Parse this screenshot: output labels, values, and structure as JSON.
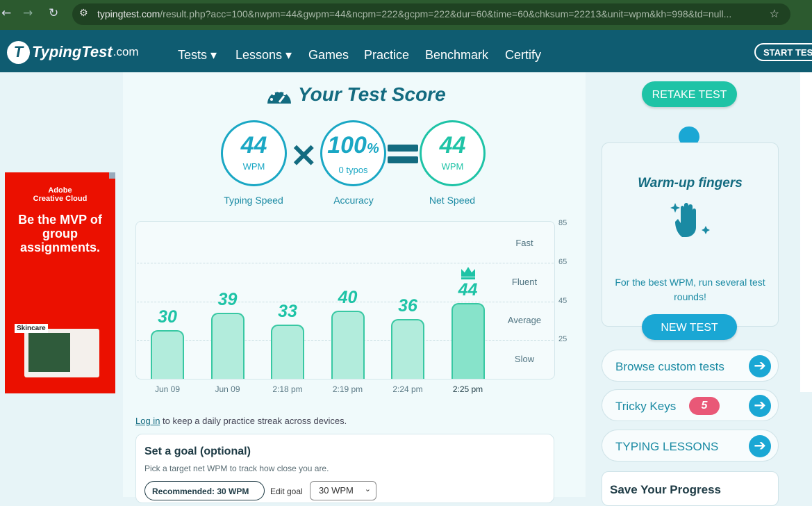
{
  "browser": {
    "url_host": "typingtest.com",
    "url_path": "/result.php?acc=100&nwpm=44&gwpm=44&ncpm=222&gcpm=222&dur=60&time=60&chksum=22213&unit=wpm&kh=998&td=null..."
  },
  "nav": {
    "logo_main": "TypingTest",
    "logo_suffix": ".com",
    "items": [
      "Tests ▾",
      "Lessons ▾",
      "Games",
      "Practice",
      "Benchmark",
      "Certify"
    ],
    "start_button": "START TEST"
  },
  "ad": {
    "brand": "Adobe\nCreative Cloud",
    "headline": "Be the MVP of group assignments.",
    "tag": "Skincare"
  },
  "score": {
    "title": "Your Test Score",
    "typing_speed": {
      "value": "44",
      "unit": "WPM",
      "label": "Typing Speed"
    },
    "accuracy": {
      "value": "100",
      "unit_symbol": "%",
      "sub": "0 typos",
      "label": "Accuracy"
    },
    "net_speed": {
      "value": "44",
      "unit": "WPM",
      "label": "Net Speed"
    }
  },
  "chart_data": {
    "type": "bar",
    "categories": [
      "Jun 09",
      "Jun 09",
      "2:18 pm",
      "2:19 pm",
      "2:24 pm",
      "2:25 pm"
    ],
    "values": [
      30,
      39,
      33,
      40,
      36,
      44
    ],
    "ylim": [
      5,
      85
    ],
    "yticks": [
      85,
      65,
      45,
      25
    ],
    "bands": [
      "Fast",
      "Fluent",
      "Average",
      "Slow"
    ],
    "highlight_last": true,
    "colors": {
      "bar": "#b2ecdc",
      "bar_last": "#87e3ca",
      "border": "#38c8a3",
      "label": "#1ec3a6"
    }
  },
  "login_line": {
    "link": "Log in",
    "text": " to keep a daily practice streak across devices."
  },
  "goal": {
    "title": "Set a goal (optional)",
    "subtitle": "Pick a target net WPM to track how close you are.",
    "recommended": "Recommended: 30 WPM",
    "edit_label": "Edit goal",
    "selected": "30 WPM"
  },
  "sidebar": {
    "retake": "RETAKE TEST",
    "warm_title": "Warm-up fingers",
    "warm_text": "For the best WPM, run several test rounds!",
    "new_test": "NEW TEST",
    "links": [
      "Browse custom tests",
      "Tricky Keys",
      "TYPING LESSONS"
    ],
    "tricky_badge": "5",
    "save_title": "Save Your Progress"
  }
}
